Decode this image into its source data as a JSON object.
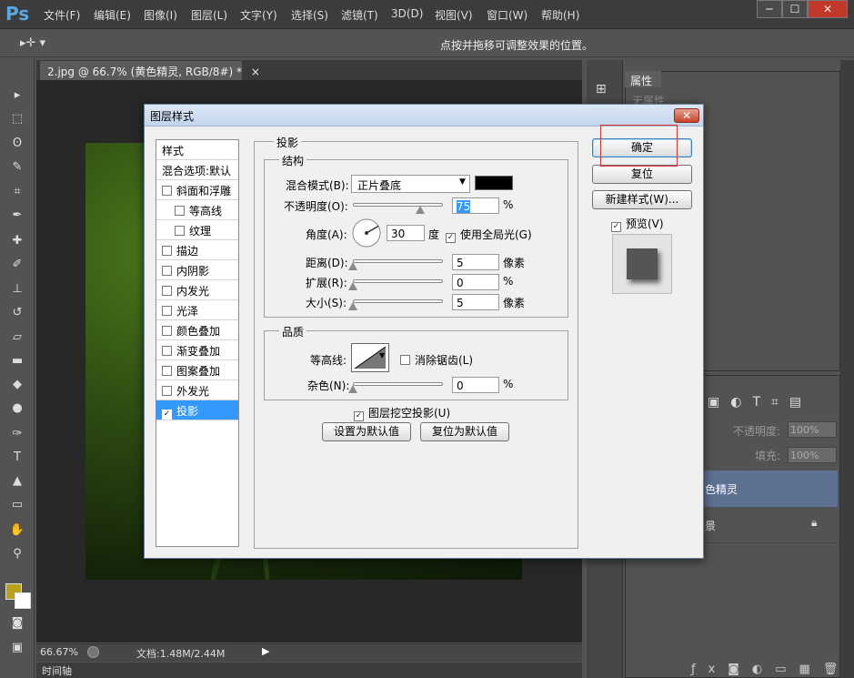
{
  "app": {
    "logo": "Ps",
    "menus": [
      "文件(F)",
      "编辑(E)",
      "图像(I)",
      "图层(L)",
      "文字(Y)",
      "选择(S)",
      "滤镜(T)",
      "3D(D)",
      "视图(V)",
      "窗口(W)",
      "帮助(H)"
    ],
    "win_min": "─",
    "win_max": "☐",
    "win_close": "✕"
  },
  "options": {
    "hint": "点按并拖移可调整效果的位置。"
  },
  "document": {
    "tab": "2.jpg @ 66.7% (黄色精灵, RGB/8#) *",
    "close": "×"
  },
  "status": {
    "zoom": "66.67%",
    "doc_size": "文档:1.48M/2.44M",
    "timeline": "时间轴"
  },
  "panels": {
    "properties_tab": "属性",
    "no_props": "无属性",
    "opacity_label": "不透明度:",
    "opacity_value": "100%",
    "fill_label": "填充:",
    "fill_value": "100%",
    "layer1": "色精灵",
    "layer2": "景"
  },
  "dialog": {
    "title": "图层样式",
    "close": "✕",
    "styles_header": "样式",
    "blend_options": "混合选项:默认",
    "style_items": [
      {
        "label": "斜面和浮雕",
        "checked": false,
        "indent": false
      },
      {
        "label": "等高线",
        "checked": false,
        "indent": true
      },
      {
        "label": "纹理",
        "checked": false,
        "indent": true
      },
      {
        "label": "描边",
        "checked": false,
        "indent": false
      },
      {
        "label": "内阴影",
        "checked": false,
        "indent": false
      },
      {
        "label": "内发光",
        "checked": false,
        "indent": false
      },
      {
        "label": "光泽",
        "checked": false,
        "indent": false
      },
      {
        "label": "颜色叠加",
        "checked": false,
        "indent": false
      },
      {
        "label": "渐变叠加",
        "checked": false,
        "indent": false
      },
      {
        "label": "图案叠加",
        "checked": false,
        "indent": false
      },
      {
        "label": "外发光",
        "checked": false,
        "indent": false
      },
      {
        "label": "投影",
        "checked": true,
        "indent": false,
        "selected": true
      }
    ],
    "section_title": "投影",
    "structure": "结构",
    "blend_mode_label": "混合模式(B):",
    "blend_mode_value": "正片叠底",
    "shadow_color": "#000000",
    "opacity_label": "不透明度(O):",
    "opacity_value": "75",
    "opacity_pct": "%",
    "angle_label": "角度(A):",
    "angle_value": "30",
    "angle_unit": "度",
    "global_light": "使用全局光(G)",
    "global_light_checked": true,
    "distance_label": "距离(D):",
    "distance_value": "5",
    "distance_unit": "像素",
    "spread_label": "扩展(R):",
    "spread_value": "0",
    "spread_unit": "%",
    "size_label": "大小(S):",
    "size_value": "5",
    "size_unit": "像素",
    "quality": "品质",
    "contour_label": "等高线:",
    "antialias": "消除锯齿(L)",
    "noise_label": "杂色(N):",
    "noise_value": "0",
    "noise_unit": "%",
    "knockout": "图层挖空投影(U)",
    "knockout_checked": true,
    "set_default": "设置为默认值",
    "reset_default": "复位为默认值",
    "ok": "确定",
    "reset": "复位",
    "new_style": "新建样式(W)...",
    "preview": "预览(V)",
    "preview_checked": true,
    "levels": {
      "opacity": 0.75,
      "distance": 0,
      "spread": 0,
      "size": 0,
      "noise": 0
    }
  }
}
